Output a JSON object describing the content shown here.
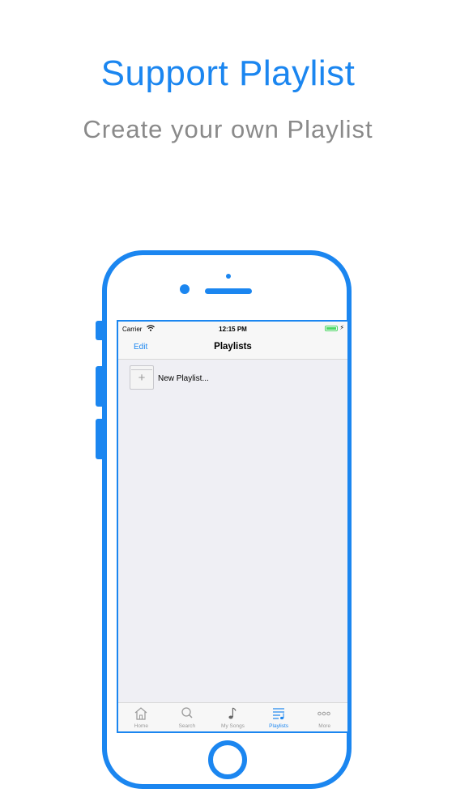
{
  "promo": {
    "headline": "Support Playlist",
    "subline": "Create your own Playlist"
  },
  "colors": {
    "accent": "#1b86f0",
    "subtitle_gray": "#8a8a8a",
    "battery_green": "#4cd964"
  },
  "statusbar": {
    "carrier": "Carrier",
    "time": "12:15 PM",
    "wifi_icon": "wifi-icon",
    "battery_icon": "battery-icon"
  },
  "navbar": {
    "edit_label": "Edit",
    "title": "Playlists"
  },
  "list": {
    "items": [
      {
        "label": "New Playlist...",
        "icon": "add-playlist-icon"
      }
    ]
  },
  "tabbar": {
    "tabs": [
      {
        "label": "Home",
        "icon": "home-icon",
        "active": false
      },
      {
        "label": "Search",
        "icon": "search-icon",
        "active": false
      },
      {
        "label": "My Songs",
        "icon": "music-note-icon",
        "active": false
      },
      {
        "label": "Playlists",
        "icon": "playlist-icon",
        "active": true
      },
      {
        "label": "More",
        "icon": "more-icon",
        "active": false
      }
    ]
  }
}
